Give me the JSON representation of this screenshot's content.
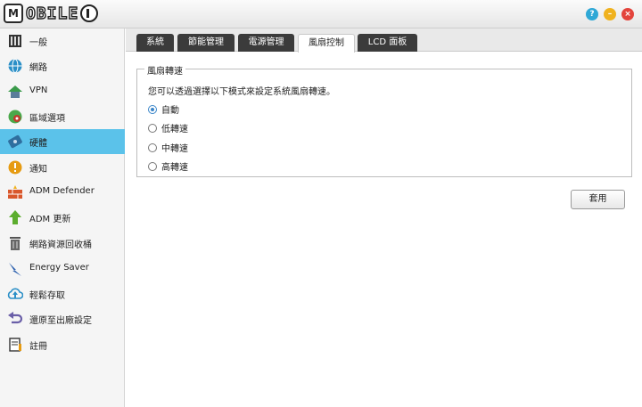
{
  "brand": {
    "logo_letter": "M",
    "logo_text": "OBILE"
  },
  "window": {
    "help_glyph": "?",
    "min_glyph": "–",
    "close_glyph": "×"
  },
  "sidebar": {
    "items": [
      {
        "label": "一般",
        "icon": "general-icon"
      },
      {
        "label": "網路",
        "icon": "network-globe-icon"
      },
      {
        "label": "VPN",
        "icon": "vpn-house-icon"
      },
      {
        "label": "區域選項",
        "icon": "region-globe-icon"
      },
      {
        "label": "硬體",
        "icon": "hardware-icon",
        "active": true
      },
      {
        "label": "通知",
        "icon": "notification-icon"
      },
      {
        "label": "ADM Defender",
        "icon": "firewall-icon"
      },
      {
        "label": "ADM 更新",
        "icon": "update-arrow-icon"
      },
      {
        "label": "網路資源回收桶",
        "icon": "recycle-bin-icon"
      },
      {
        "label": "Energy Saver",
        "icon": "energy-saver-icon"
      },
      {
        "label": "輕鬆存取",
        "icon": "cloud-access-icon"
      },
      {
        "label": "還原至出廠設定",
        "icon": "restore-arrow-icon"
      },
      {
        "label": "註冊",
        "icon": "register-icon"
      }
    ]
  },
  "tabs": [
    {
      "label": "系統"
    },
    {
      "label": "節能管理"
    },
    {
      "label": "電源管理"
    },
    {
      "label": "風扇控制",
      "active": true
    },
    {
      "label": "LCD 面板"
    }
  ],
  "fan_control": {
    "legend": "風扇轉速",
    "description": "您可以透過選擇以下模式來設定系統風扇轉速。",
    "options": [
      {
        "label": "自動",
        "checked": true
      },
      {
        "label": "低轉速",
        "checked": false
      },
      {
        "label": "中轉速",
        "checked": false
      },
      {
        "label": "高轉速",
        "checked": false
      }
    ]
  },
  "apply_label": "套用",
  "colors": {
    "active_nav": "#5bc2ea",
    "tab_dark": "#3b3b3b",
    "radio_accent": "#3b86c9",
    "help_btn": "#2fa8d6",
    "min_btn": "#f0b21e",
    "close_btn": "#e3443c"
  }
}
